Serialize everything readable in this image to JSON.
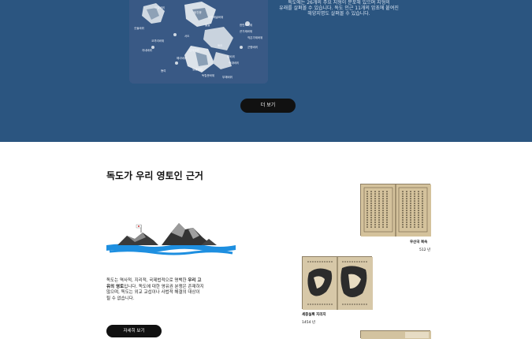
{
  "intro_text": "독도에는 26개의 주요 지형이 분포해 있으며 지형의 유래를 살펴볼 수 있습니다. 독도 인근 11개의 암초에 붙여진 해양지명도 살펴볼 수 있습니다.",
  "intro_lines": [
    "독도에는 26개의 주요 지형이 분포해 있으며 지형의",
    "유래를 살펴볼 수 있습니다. 독도 인근 11개의 암초에 붙여진",
    "해양지명도 살펴볼 수 있습니다."
  ],
  "map_labels": [
    "숫돌바위",
    "보찰바위",
    "탕건봉",
    "삼형제굴바위",
    "물골",
    "한반도바위",
    "큰가제바위",
    "작은가제바위",
    "코끼리바위",
    "지네바위",
    "넙덕바위",
    "군함바위",
    "닭바위",
    "촛대바위",
    "얼굴바위",
    "독립문바위",
    "부채바위",
    "해녀바위",
    "똥여",
    "서도",
    "동도"
  ],
  "more_button": "더 보기",
  "section_title": "독도가 우리 영토인 근거",
  "evidence": {
    "part1": "독도는 역사적, 지리적, 국제법적으로 명백한 ",
    "bold": "우리 고유의 영토",
    "part2": "입니다. 독도에 대한 영유권 분쟁은 존재하지 않으며, 독도는 외교 교섭이나 사법적 해결의 대상이 될 수 없습니다."
  },
  "detail_button": "자세히 보기",
  "documents": [
    {
      "title": "우산국 복속",
      "year": "512 년"
    },
    {
      "title": "세종실록 지리지",
      "year": "1454 년"
    }
  ],
  "colors": {
    "top_background": "#2b5580",
    "button": "#111111",
    "sea": "#1e8fe0"
  }
}
